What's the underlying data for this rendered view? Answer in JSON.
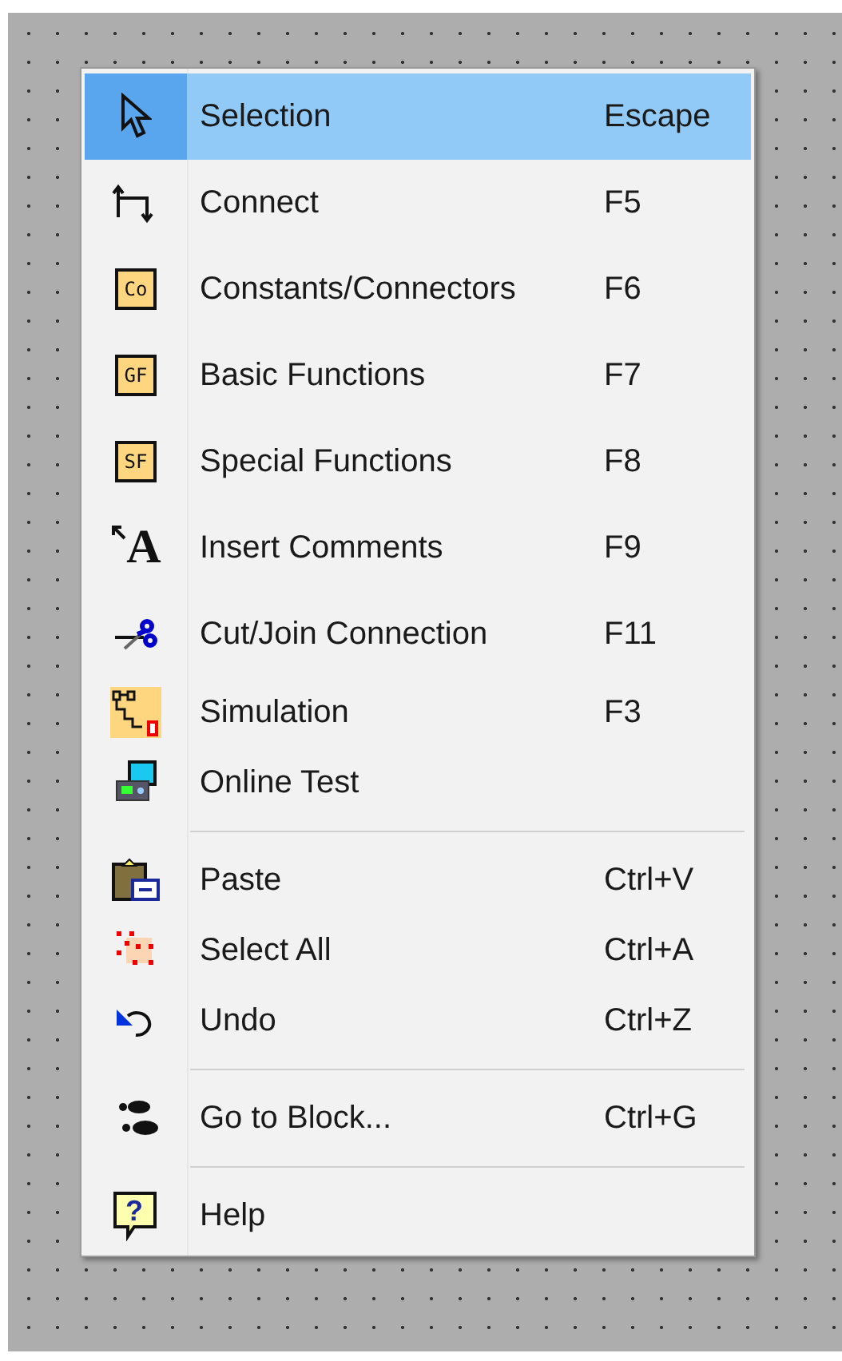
{
  "menu": {
    "sections": [
      {
        "items": [
          {
            "label": "Selection",
            "shortcut": "Escape",
            "kind": "pointer",
            "selected": true
          },
          {
            "label": "Connect",
            "shortcut": "F5",
            "kind": "connect",
            "selected": false
          },
          {
            "label": "Constants/Connectors",
            "shortcut": "F6",
            "kind": "labelbox",
            "icon_text": "Co",
            "selected": false
          },
          {
            "label": "Basic Functions",
            "shortcut": "F7",
            "kind": "labelbox",
            "icon_text": "GF",
            "selected": false
          },
          {
            "label": "Special Functions",
            "shortcut": "F8",
            "kind": "labelbox",
            "icon_text": "SF",
            "selected": false
          },
          {
            "label": "Insert Comments",
            "shortcut": "F9",
            "kind": "letter",
            "icon_text": "A",
            "selected": false
          },
          {
            "label": "Cut/Join Connection",
            "shortcut": "F11",
            "kind": "scissors",
            "selected": false
          },
          {
            "label": "Simulation",
            "shortcut": "F3",
            "kind": "simulation",
            "selected": false
          },
          {
            "label": "Online Test",
            "kind": "computer",
            "selected": false
          }
        ]
      },
      {
        "items": [
          {
            "label": "Paste",
            "shortcut": "Ctrl+V",
            "kind": "clipboard",
            "selected": false
          },
          {
            "label": "Select All",
            "shortcut": "Ctrl+A",
            "kind": "selectall",
            "selected": false
          },
          {
            "label": "Undo",
            "shortcut": "Ctrl+Z",
            "kind": "undo",
            "selected": false
          }
        ]
      },
      {
        "items": [
          {
            "label": "Go to Block...",
            "shortcut": "Ctrl+G",
            "kind": "footprints",
            "selected": false
          }
        ]
      },
      {
        "items": [
          {
            "label": "Help",
            "kind": "help",
            "icon_text": "?",
            "selected": false
          }
        ]
      }
    ]
  }
}
